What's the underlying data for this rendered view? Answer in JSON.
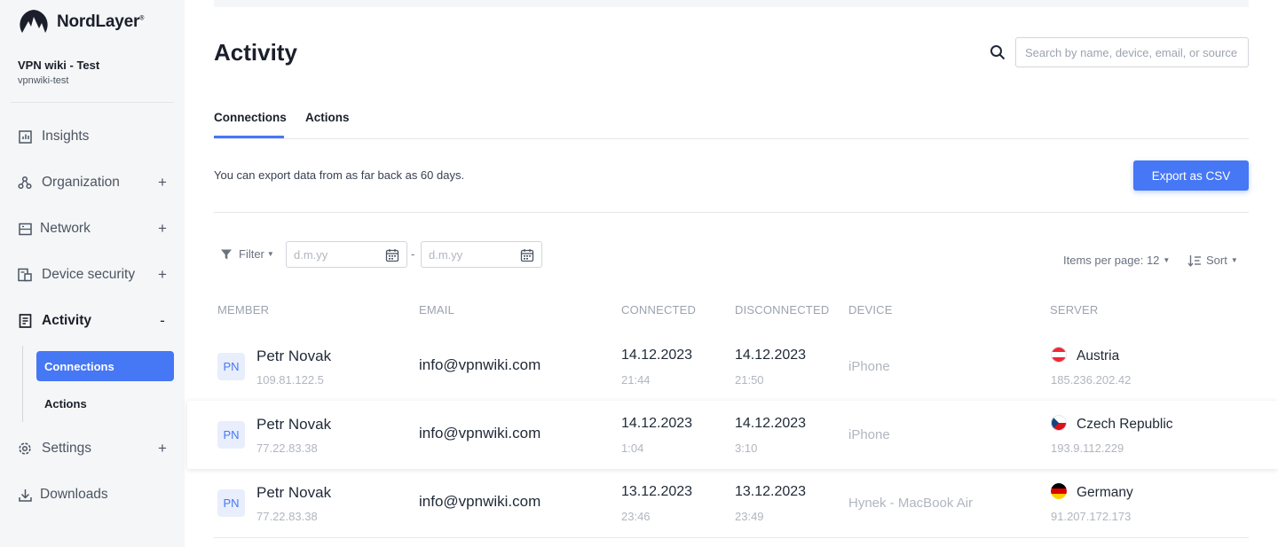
{
  "brand": {
    "name": "NordLayer",
    "trademark": "®"
  },
  "organization": {
    "name": "VPN wiki - Test",
    "id": "vpnwiki-test"
  },
  "sidebar": {
    "items": [
      {
        "label": "Insights",
        "icon": "insights-icon",
        "expand": ""
      },
      {
        "label": "Organization",
        "icon": "organization-icon",
        "expand": "+"
      },
      {
        "label": "Network",
        "icon": "network-icon",
        "expand": "+"
      },
      {
        "label": "Device security",
        "icon": "device-security-icon",
        "expand": "+"
      },
      {
        "label": "Activity",
        "icon": "activity-icon",
        "expand": "-"
      },
      {
        "label": "Settings",
        "icon": "settings-icon",
        "expand": "+"
      },
      {
        "label": "Downloads",
        "icon": "downloads-icon",
        "expand": ""
      }
    ],
    "activity_subitems": [
      {
        "label": "Connections",
        "selected": true
      },
      {
        "label": "Actions",
        "selected": false
      }
    ]
  },
  "page": {
    "title": "Activity",
    "search_placeholder": "Search by name, device, email, or source"
  },
  "tabs": [
    {
      "label": "Connections",
      "active": true
    },
    {
      "label": "Actions",
      "active": false
    }
  ],
  "export": {
    "note": "You can export data from as far back as 60 days.",
    "button_label": "Export as CSV"
  },
  "filters": {
    "filter_label": "Filter",
    "date_from_placeholder": "d.m.yy",
    "date_separator": "-",
    "date_to_placeholder": "d.m.yy",
    "items_per_page_label": "Items per page: 12",
    "sort_label": "Sort"
  },
  "table": {
    "columns": [
      "MEMBER",
      "EMAIL",
      "CONNECTED",
      "DISCONNECTED",
      "DEVICE",
      "SERVER"
    ],
    "rows": [
      {
        "initials": "PN",
        "name": "Petr Novak",
        "ip": "109.81.122.5",
        "email": "info@vpnwiki.com",
        "connected_date": "14.12.2023",
        "connected_time": "21:44",
        "disconnected_date": "14.12.2023",
        "disconnected_time": "21:50",
        "device": "iPhone",
        "server_country": "Austria",
        "server_ip": "185.236.202.42",
        "flag": "austria-flag-icon"
      },
      {
        "initials": "PN",
        "name": "Petr Novak",
        "ip": "77.22.83.38",
        "email": "info@vpnwiki.com",
        "connected_date": "14.12.2023",
        "connected_time": "1:04",
        "disconnected_date": "14.12.2023",
        "disconnected_time": "3:10",
        "device": "iPhone",
        "server_country": "Czech Republic",
        "server_ip": "193.9.112.229",
        "flag": "czech-flag-icon"
      },
      {
        "initials": "PN",
        "name": "Petr Novak",
        "ip": "77.22.83.38",
        "email": "info@vpnwiki.com",
        "connected_date": "13.12.2023",
        "connected_time": "23:46",
        "disconnected_date": "13.12.2023",
        "disconnected_time": "23:49",
        "device": "Hynek - MacBook Air",
        "server_country": "Germany",
        "server_ip": "91.207.172.173",
        "flag": "germany-flag-icon"
      }
    ]
  },
  "colors": {
    "accent": "#4677f5",
    "sidebar_bg": "#f5f6f7",
    "text_dark": "#1a1f2b",
    "muted": "#9ca3af"
  }
}
